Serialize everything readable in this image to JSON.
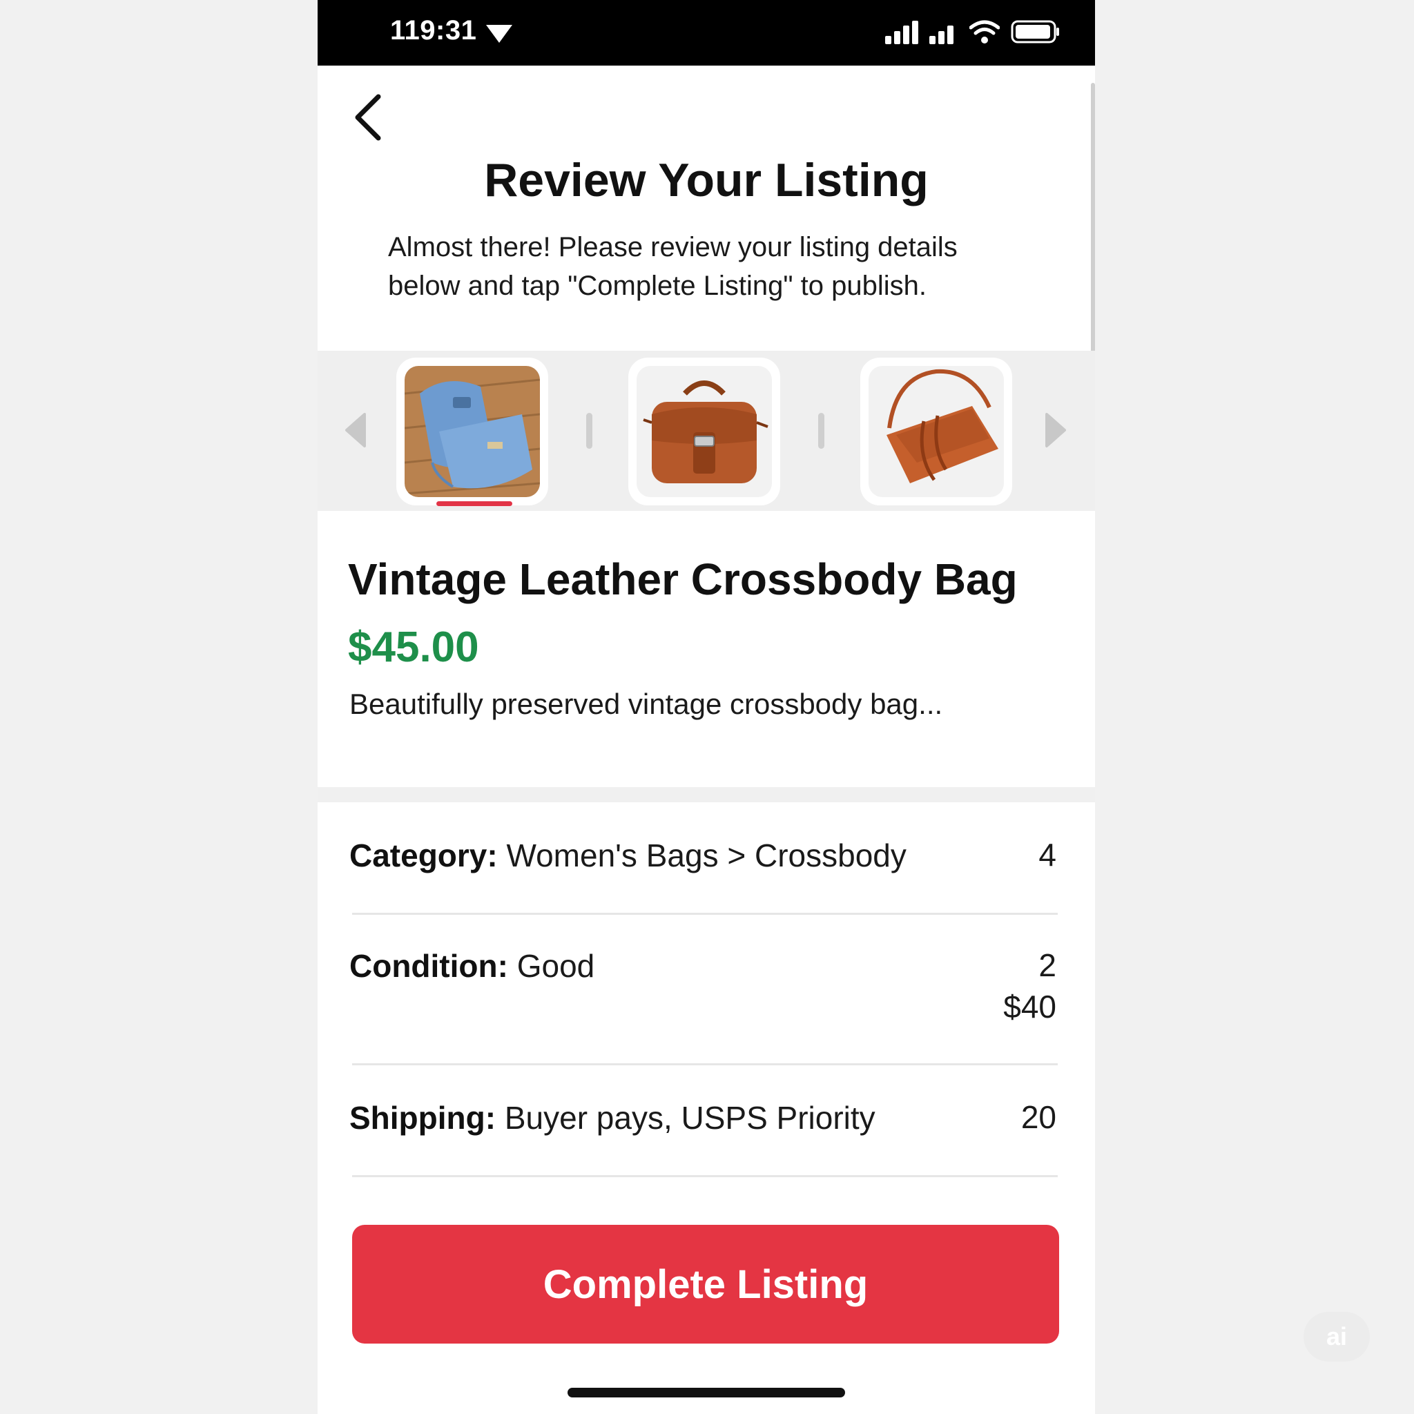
{
  "status_bar": {
    "time": "119:31"
  },
  "header": {
    "title": "Review Your Listing",
    "subtitle_line1": "Almost there! Please review your listing details",
    "subtitle_line2": "below and tap \"Complete Listing\" to publish."
  },
  "carousel": {
    "selected_index": 0,
    "photos": [
      {
        "subject": "denim-backpack"
      },
      {
        "subject": "brown-leather-satchel"
      },
      {
        "subject": "brown-leather-crossbody"
      }
    ]
  },
  "product": {
    "title": "Vintage Leather Crossbody Bag",
    "price": "$45.00",
    "description": "Beautifully preserved vintage crossbody bag..."
  },
  "details": {
    "category": {
      "label": "Category:",
      "value": "Women's Bags > Crossbody",
      "right": "4"
    },
    "condition": {
      "label": "Condition:",
      "value": "Good",
      "right_line1": "2",
      "right_line2": "$40"
    },
    "shipping": {
      "label": "Shipping:",
      "value": "Buyer pays, USPS Priority",
      "right": "20"
    }
  },
  "cta": {
    "label": "Complete Listing"
  },
  "watermark": {
    "text": "ai"
  },
  "colors": {
    "accent": "#e43543",
    "price": "#1e8f4a",
    "status_bar": "#000000",
    "background": "#f1f1f1"
  },
  "icons": [
    "back-chevron-icon",
    "location-arrow-icon",
    "cellular-signal-icon",
    "wifi-icon",
    "battery-icon",
    "carousel-left-arrow-icon",
    "carousel-right-arrow-icon"
  ]
}
